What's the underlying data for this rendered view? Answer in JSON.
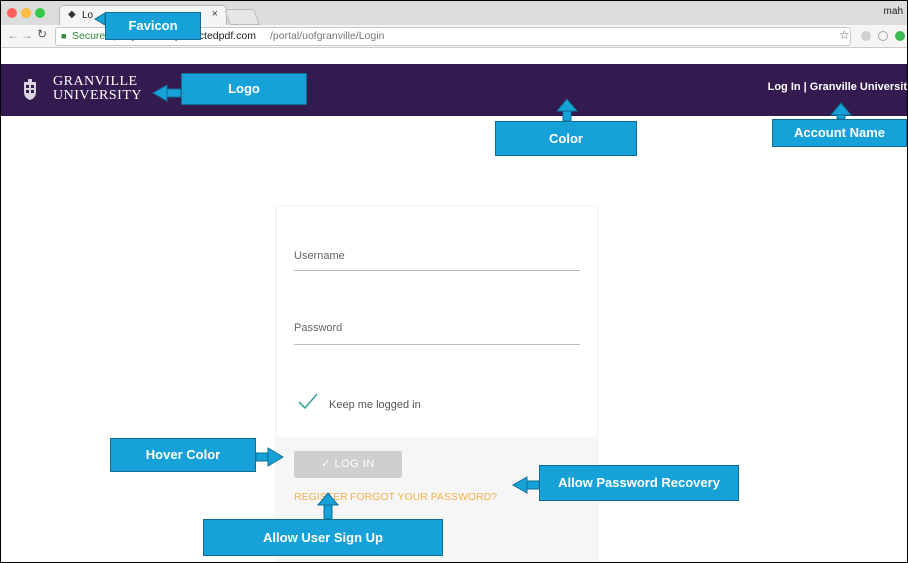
{
  "browser": {
    "tab_title": "Lo",
    "tab_close": "×",
    "user": "mah",
    "secure_label": "Secure",
    "url_separator": "|",
    "url_host": "https://view.protectedpdf.com",
    "url_path": "/portal/uofgranville/Login"
  },
  "site": {
    "logo_line1": "GRANVILLE",
    "logo_line2": "UNIVERSITY",
    "account_link": "Log In | Granville Universit",
    "header_color": "#331a4f"
  },
  "login": {
    "username_label": "Username",
    "password_label": "Password",
    "keep_logged_in": "Keep me logged in",
    "login_button": "✓   LOG IN",
    "register_link": "REGISTER",
    "forgot_link": "FORGOT YOUR PASSWORD?"
  },
  "annotations": {
    "favicon": "Favicon",
    "logo": "Logo",
    "color": "Color",
    "account_name": "Account Name",
    "hover_color": "Hover Color",
    "password_recovery": "Allow Password Recovery",
    "user_signup": "Allow User Sign Up"
  },
  "colors": {
    "accent": "#16a2d8",
    "link": "#f0b24a",
    "secure": "#2e8b3a"
  }
}
